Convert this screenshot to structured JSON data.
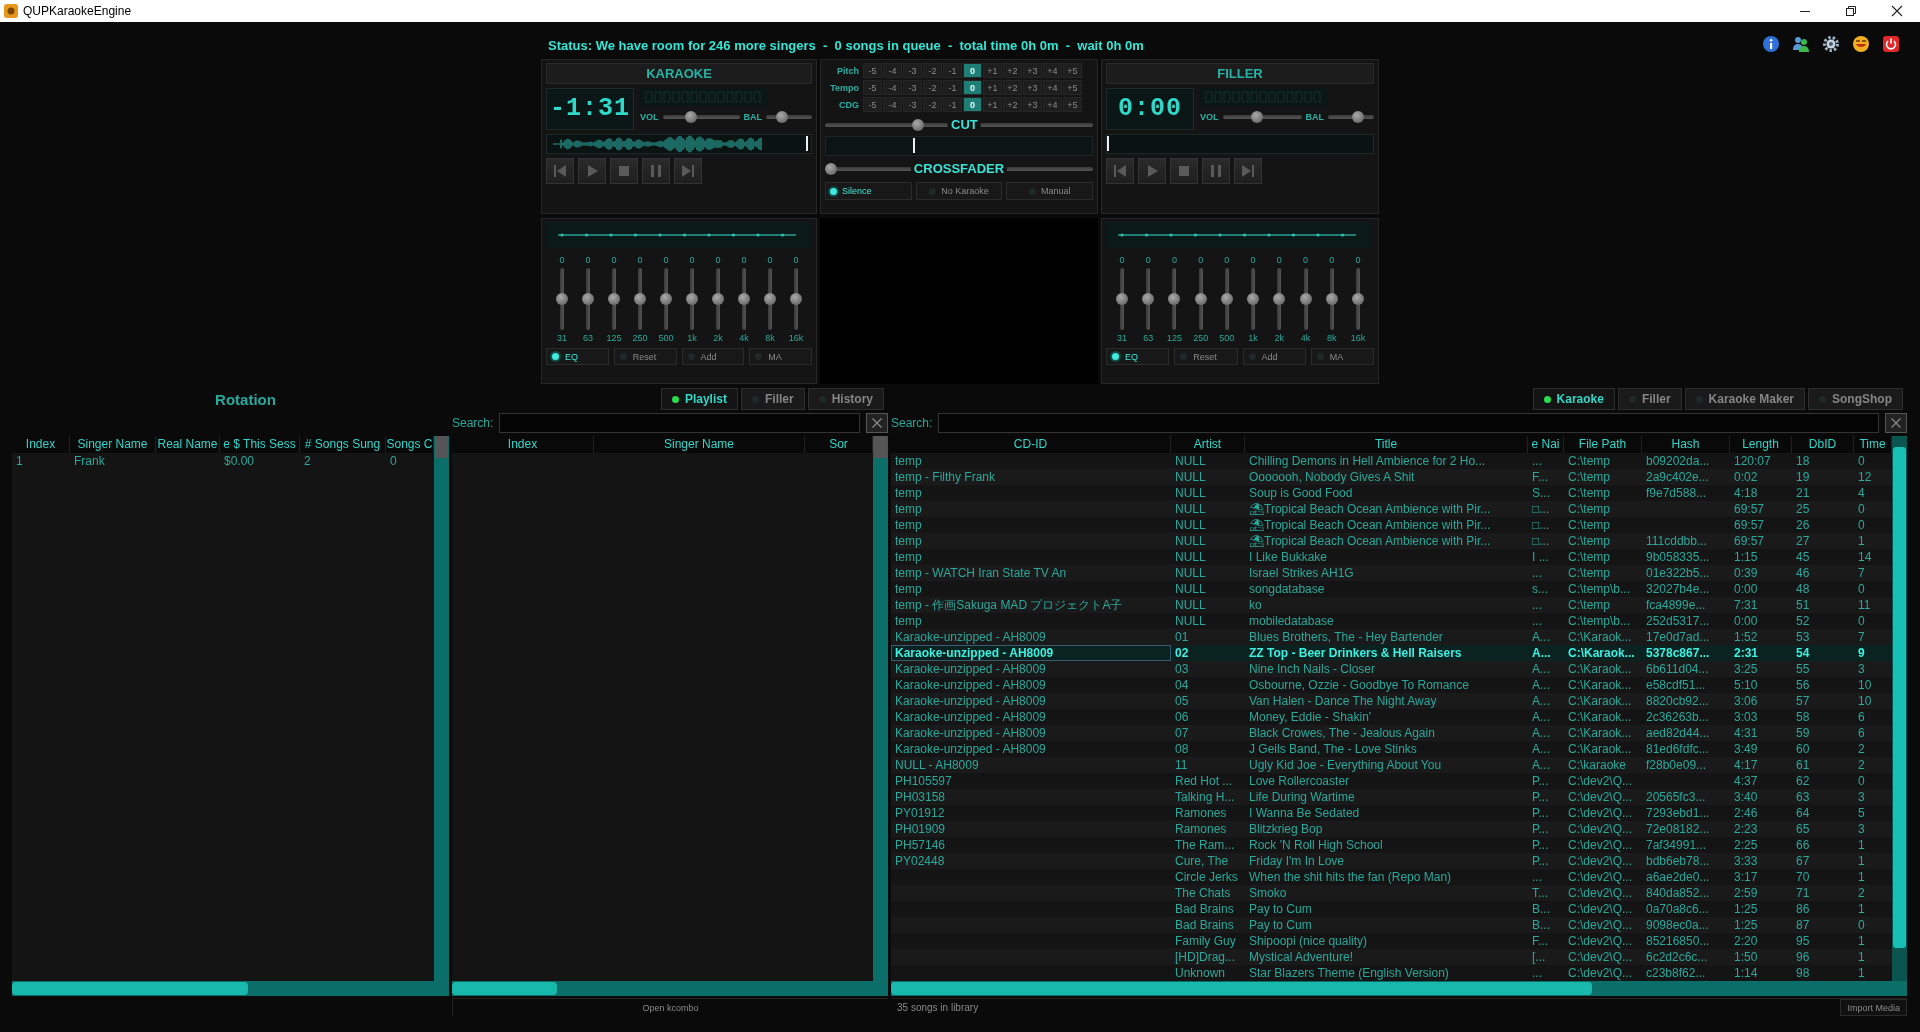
{
  "window": {
    "title": "QUPKaraokeEngine"
  },
  "status": "Status: We have room for 246 more singers  -  0 songs in queue  -  total time 0h 0m  -  wait 0h 0m",
  "karaoke_deck": {
    "title": "KARAOKE",
    "time": "-1:31",
    "vol_label": "VOL",
    "bal_label": "BAL",
    "volume": {
      "level": 0.35
    },
    "balance": {
      "level": 0.3
    },
    "waveform": true,
    "position": {
      "level": 0.99
    }
  },
  "center_deck": {
    "rows": [
      {
        "label": "Pitch",
        "steps": [
          {
            "label": "-5",
            "selected": false
          },
          {
            "label": "-4",
            "selected": false
          },
          {
            "label": "-3",
            "selected": false
          },
          {
            "label": "-2",
            "selected": false
          },
          {
            "label": "-1",
            "selected": false
          },
          {
            "label": "0",
            "selected": true
          },
          {
            "label": "+1",
            "selected": false
          },
          {
            "label": "+2",
            "selected": false
          },
          {
            "label": "+3",
            "selected": false
          },
          {
            "label": "+4",
            "selected": false
          },
          {
            "label": "+5",
            "selected": false
          }
        ]
      },
      {
        "label": "Tempo",
        "steps": [
          {
            "label": "-5",
            "selected": false
          },
          {
            "label": "-4",
            "selected": false
          },
          {
            "label": "-3",
            "selected": false
          },
          {
            "label": "-2",
            "selected": false
          },
          {
            "label": "-1",
            "selected": false
          },
          {
            "label": "0",
            "selected": true
          },
          {
            "label": "+1",
            "selected": false
          },
          {
            "label": "+2",
            "selected": false
          },
          {
            "label": "+3",
            "selected": false
          },
          {
            "label": "+4",
            "selected": false
          },
          {
            "label": "+5",
            "selected": false
          }
        ]
      },
      {
        "label": "CDG",
        "steps": [
          {
            "label": "-5",
            "selected": false
          },
          {
            "label": "-4",
            "selected": false
          },
          {
            "label": "-3",
            "selected": false
          },
          {
            "label": "-2",
            "selected": false
          },
          {
            "label": "-1",
            "selected": false
          },
          {
            "label": "0",
            "selected": true
          },
          {
            "label": "+1",
            "selected": false
          },
          {
            "label": "+2",
            "selected": false
          },
          {
            "label": "+3",
            "selected": false
          },
          {
            "label": "+4",
            "selected": false
          },
          {
            "label": "+5",
            "selected": false
          }
        ]
      }
    ],
    "cut": {
      "label": "CUT",
      "level": 0.34
    },
    "cut_position": {
      "level": 0.33
    },
    "crossfader": {
      "label": "CROSSFADER",
      "level": 0
    },
    "modes": [
      {
        "label": "Silence",
        "selected": true
      },
      {
        "label": "No Karaoke",
        "selected": false
      },
      {
        "label": "Manual",
        "selected": false
      }
    ]
  },
  "filler_deck": {
    "title": "FILLER",
    "time": "0:00",
    "vol_label": "VOL",
    "bal_label": "BAL",
    "volume": {
      "level": 0.43
    },
    "balance": {
      "level": 0.72
    },
    "position": {
      "level": 0
    }
  },
  "karaoke_eq": {
    "bands": [
      {
        "value": "0",
        "freq": "31",
        "level": 0.5
      },
      {
        "value": "0",
        "freq": "63",
        "level": 0.5
      },
      {
        "value": "0",
        "freq": "125",
        "level": 0.5
      },
      {
        "value": "0",
        "freq": "250",
        "level": 0.5
      },
      {
        "value": "0",
        "freq": "500",
        "level": 0.5
      },
      {
        "value": "0",
        "freq": "1k",
        "level": 0.5
      },
      {
        "value": "0",
        "freq": "2k",
        "level": 0.5
      },
      {
        "value": "0",
        "freq": "4k",
        "level": 0.5
      },
      {
        "value": "0",
        "freq": "8k",
        "level": 0.5
      },
      {
        "value": "0",
        "freq": "16k",
        "level": 0.5
      }
    ],
    "buttons": [
      {
        "label": "EQ",
        "on": true
      },
      {
        "label": "Reset",
        "on": false
      },
      {
        "label": "Add",
        "on": false
      },
      {
        "label": "MA",
        "on": false
      }
    ]
  },
  "filler_eq": {
    "bands": [
      {
        "value": "0",
        "freq": "31",
        "level": 0.5
      },
      {
        "value": "0",
        "freq": "63",
        "level": 0.5
      },
      {
        "value": "0",
        "freq": "125",
        "level": 0.5
      },
      {
        "value": "0",
        "freq": "250",
        "level": 0.5
      },
      {
        "value": "0",
        "freq": "500",
        "level": 0.5
      },
      {
        "value": "0",
        "freq": "1k",
        "level": 0.5
      },
      {
        "value": "0",
        "freq": "2k",
        "level": 0.5
      },
      {
        "value": "0",
        "freq": "4k",
        "level": 0.5
      },
      {
        "value": "0",
        "freq": "8k",
        "level": 0.5
      },
      {
        "value": "0",
        "freq": "16k",
        "level": 0.5
      }
    ],
    "buttons": [
      {
        "label": "EQ",
        "on": true
      },
      {
        "label": "Reset",
        "on": false
      },
      {
        "label": "Add",
        "on": false
      },
      {
        "label": "MA",
        "on": false
      }
    ]
  },
  "rotation": {
    "title": "Rotation",
    "columns": [
      "Index",
      "Singer Name",
      "Real Name",
      "e $ This Sess",
      "# Songs Sung",
      "Songs C"
    ],
    "rows": [
      {
        "cells": [
          "1",
          "Frank",
          null,
          "$0.00",
          "2",
          "0"
        ]
      }
    ]
  },
  "queue_tabs": [
    {
      "label": "Playlist",
      "selected": true
    },
    {
      "label": "Filler",
      "selected": false
    },
    {
      "label": "History",
      "selected": false
    }
  ],
  "queue_search": {
    "label": "Search:"
  },
  "queue": {
    "columns": [
      "Index",
      "Singer Name",
      "Sor"
    ]
  },
  "library_tabs": [
    {
      "label": "Karaoke",
      "selected": true
    },
    {
      "label": "Filler",
      "selected": false
    },
    {
      "label": "Karaoke Maker",
      "selected": false
    },
    {
      "label": "SongShop",
      "selected": false
    }
  ],
  "library_search": {
    "label": "Search:"
  },
  "songs": {
    "columns": [
      "CD-ID",
      "Artist",
      "Title",
      "e Nai",
      "File Path",
      "Hash",
      "Length",
      "DbID",
      "Time"
    ],
    "rows": [
      {
        "cells": [
          "temp",
          "NULL",
          "Chilling Demons in Hell Ambience for 2 Ho...",
          "...",
          "C:\\temp",
          "b09202da...",
          "120:07",
          "18",
          "0"
        ],
        "selected": false
      },
      {
        "cells": [
          "temp - Filthy Frank",
          "NULL",
          "Ooooooh, Nobody Gives A Shit",
          "F...",
          "C:\\temp",
          "2a9c402e...",
          "0:02",
          "19",
          "12"
        ],
        "selected": false
      },
      {
        "cells": [
          "temp",
          "NULL",
          "Soup is Good Food",
          "S...",
          "C:\\temp",
          "f9e7d588...",
          "4:18",
          "21",
          "4"
        ],
        "selected": false
      },
      {
        "cells": [
          "temp",
          "NULL",
          "⛱Tropical Beach Ocean Ambience with Pir...",
          "□...",
          "C:\\temp",
          null,
          "69:57",
          "25",
          "0"
        ],
        "selected": false
      },
      {
        "cells": [
          "temp",
          "NULL",
          "⛱Tropical Beach Ocean Ambience with Pir...",
          "□...",
          "C:\\temp",
          null,
          "69:57",
          "26",
          "0"
        ],
        "selected": false
      },
      {
        "cells": [
          "temp",
          "NULL",
          "⛱Tropical Beach Ocean Ambience with Pir...",
          "□...",
          "C:\\temp",
          "111cddbb...",
          "69:57",
          "27",
          "1"
        ],
        "selected": false
      },
      {
        "cells": [
          "temp",
          "NULL",
          "I Like Bukkake",
          "I ...",
          "C:\\temp",
          "9b058335...",
          "1:15",
          "45",
          "14"
        ],
        "selected": false
      },
      {
        "cells": [
          "temp - WATCH Iran State TV An",
          "NULL",
          "Israel Strikes  AH1G",
          "...",
          "C:\\temp",
          "01e322b5...",
          "0:39",
          "46",
          "7"
        ],
        "selected": false
      },
      {
        "cells": [
          "temp",
          "NULL",
          "songdatabase",
          "s...",
          "C:\\temp\\b...",
          "32027b4e...",
          "0:00",
          "48",
          "0"
        ],
        "selected": false
      },
      {
        "cells": [
          "temp - 作画Sakuga MAD プロジェクトA子",
          "NULL",
          "ko",
          "...",
          "C:\\temp",
          "fca4899e...",
          "7:31",
          "51",
          "11"
        ],
        "selected": false
      },
      {
        "cells": [
          "temp",
          "NULL",
          "mobiledatabase",
          "...",
          "C:\\temp\\b...",
          "252d5317...",
          "0:00",
          "52",
          "0"
        ],
        "selected": false
      },
      {
        "cells": [
          "Karaoke-unzipped - AH8009",
          "01",
          "Blues Brothers, The - Hey Bartender",
          "A...",
          "C:\\Karaok...",
          "17e0d7ad...",
          "1:52",
          "53",
          "7"
        ],
        "selected": false
      },
      {
        "cells": [
          "Karaoke-unzipped - AH8009",
          "02",
          "ZZ Top - Beer Drinkers & Hell Raisers",
          "A...",
          "C:\\Karaok...",
          "5378c867...",
          "2:31",
          "54",
          "9"
        ],
        "selected": true
      },
      {
        "cells": [
          "Karaoke-unzipped - AH8009",
          "03",
          "Nine Inch Nails - Closer",
          "A...",
          "C:\\Karaok...",
          "6b611d04...",
          "3:25",
          "55",
          "3"
        ],
        "selected": false
      },
      {
        "cells": [
          "Karaoke-unzipped - AH8009",
          "04",
          "Osbourne, Ozzie - Goodbye To Romance",
          "A...",
          "C:\\Karaok...",
          "e58cdf51...",
          "5:10",
          "56",
          "10"
        ],
        "selected": false
      },
      {
        "cells": [
          "Karaoke-unzipped - AH8009",
          "05",
          "Van Halen - Dance The Night Away",
          "A...",
          "C:\\Karaok...",
          "8820cb92...",
          "3:06",
          "57",
          "10"
        ],
        "selected": false
      },
      {
        "cells": [
          "Karaoke-unzipped - AH8009",
          "06",
          "Money, Eddie - Shakin'",
          "A...",
          "C:\\Karaok...",
          "2c36263b...",
          "3:03",
          "58",
          "6"
        ],
        "selected": false
      },
      {
        "cells": [
          "Karaoke-unzipped - AH8009",
          "07",
          "Black Crowes, The - Jealous Again",
          "A...",
          "C:\\Karaok...",
          "aed82d44...",
          "4:31",
          "59",
          "6"
        ],
        "selected": false
      },
      {
        "cells": [
          "Karaoke-unzipped - AH8009",
          "08",
          "J Geils Band, The - Love Stinks",
          "A...",
          "C:\\Karaok...",
          "81ed6fdfc...",
          "3:49",
          "60",
          "2"
        ],
        "selected": false
      },
      {
        "cells": [
          "NULL - AH8009",
          "11",
          "Ugly Kid Joe - Everything About You",
          "A...",
          "C:\\karaoke",
          "f28b0e09...",
          "4:17",
          "61",
          "2"
        ],
        "selected": false
      },
      {
        "cells": [
          "PH105597",
          "Red Hot ...",
          "Love Rollercoaster",
          "P...",
          "C:\\dev2\\Q...",
          null,
          "4:37",
          "62",
          "0"
        ],
        "selected": false
      },
      {
        "cells": [
          "PH03158",
          "Talking H...",
          "Life During Wartime",
          "P...",
          "C:\\dev2\\Q...",
          "20565fc3...",
          "3:40",
          "63",
          "3"
        ],
        "selected": false
      },
      {
        "cells": [
          "PY01912",
          "Ramones",
          "I Wanna Be Sedated",
          "P...",
          "C:\\dev2\\Q...",
          "7293ebd1...",
          "2:46",
          "64",
          "5"
        ],
        "selected": false
      },
      {
        "cells": [
          "PH01909",
          "Ramones",
          "Blitzkrieg Bop",
          "P...",
          "C:\\dev2\\Q...",
          "72e08182...",
          "2:23",
          "65",
          "3"
        ],
        "selected": false
      },
      {
        "cells": [
          "PH57146",
          "The Ram...",
          "Rock 'N Roll High School",
          "P...",
          "C:\\dev2\\Q...",
          "7af34991...",
          "2:25",
          "66",
          "1"
        ],
        "selected": false
      },
      {
        "cells": [
          "PY02448",
          "Cure, The",
          "Friday I'm In Love",
          "P...",
          "C:\\dev2\\Q...",
          "bdb6eb78...",
          "3:33",
          "67",
          "1"
        ],
        "selected": false
      },
      {
        "cells": [
          null,
          "Circle Jerks",
          "When the shit hits the fan (Repo Man)",
          "...",
          "C:\\dev2\\Q...",
          "a6ae2de0...",
          "3:17",
          "70",
          "1"
        ],
        "selected": false
      },
      {
        "cells": [
          null,
          "The Chats",
          "Smoko",
          "T...",
          "C:\\dev2\\Q...",
          "840da852...",
          "2:59",
          "71",
          "2"
        ],
        "selected": false
      },
      {
        "cells": [
          null,
          "Bad Brains",
          "Pay to Cum",
          "B...",
          "C:\\dev2\\Q...",
          "0a70a8c6...",
          "1:25",
          "86",
          "1"
        ],
        "selected": false
      },
      {
        "cells": [
          null,
          "Bad Brains",
          "Pay to Cum",
          "B...",
          "C:\\dev2\\Q...",
          "9098ec0a...",
          "1:25",
          "87",
          "0"
        ],
        "selected": false
      },
      {
        "cells": [
          null,
          "Family Guy",
          "Shipoopi (nice quality)",
          "F...",
          "C:\\dev2\\Q...",
          "85216850...",
          "2:20",
          "95",
          "1"
        ],
        "selected": false
      },
      {
        "cells": [
          null,
          "[HD]Drag...",
          "Mystical Adventure!",
          "[...",
          "C:\\dev2\\Q...",
          "6c2d2c6c...",
          "1:50",
          "96",
          "1"
        ],
        "selected": false
      },
      {
        "cells": [
          null,
          "Unknown",
          "Star Blazers Theme (English Version)",
          "...",
          "C:\\dev2\\Q...",
          "c23b8f62...",
          "1:14",
          "98",
          "1"
        ],
        "selected": false
      }
    ]
  },
  "footer": {
    "queue_note": "Open kcombo",
    "library_note": "35 songs in library",
    "import_button": "Import Media"
  }
}
